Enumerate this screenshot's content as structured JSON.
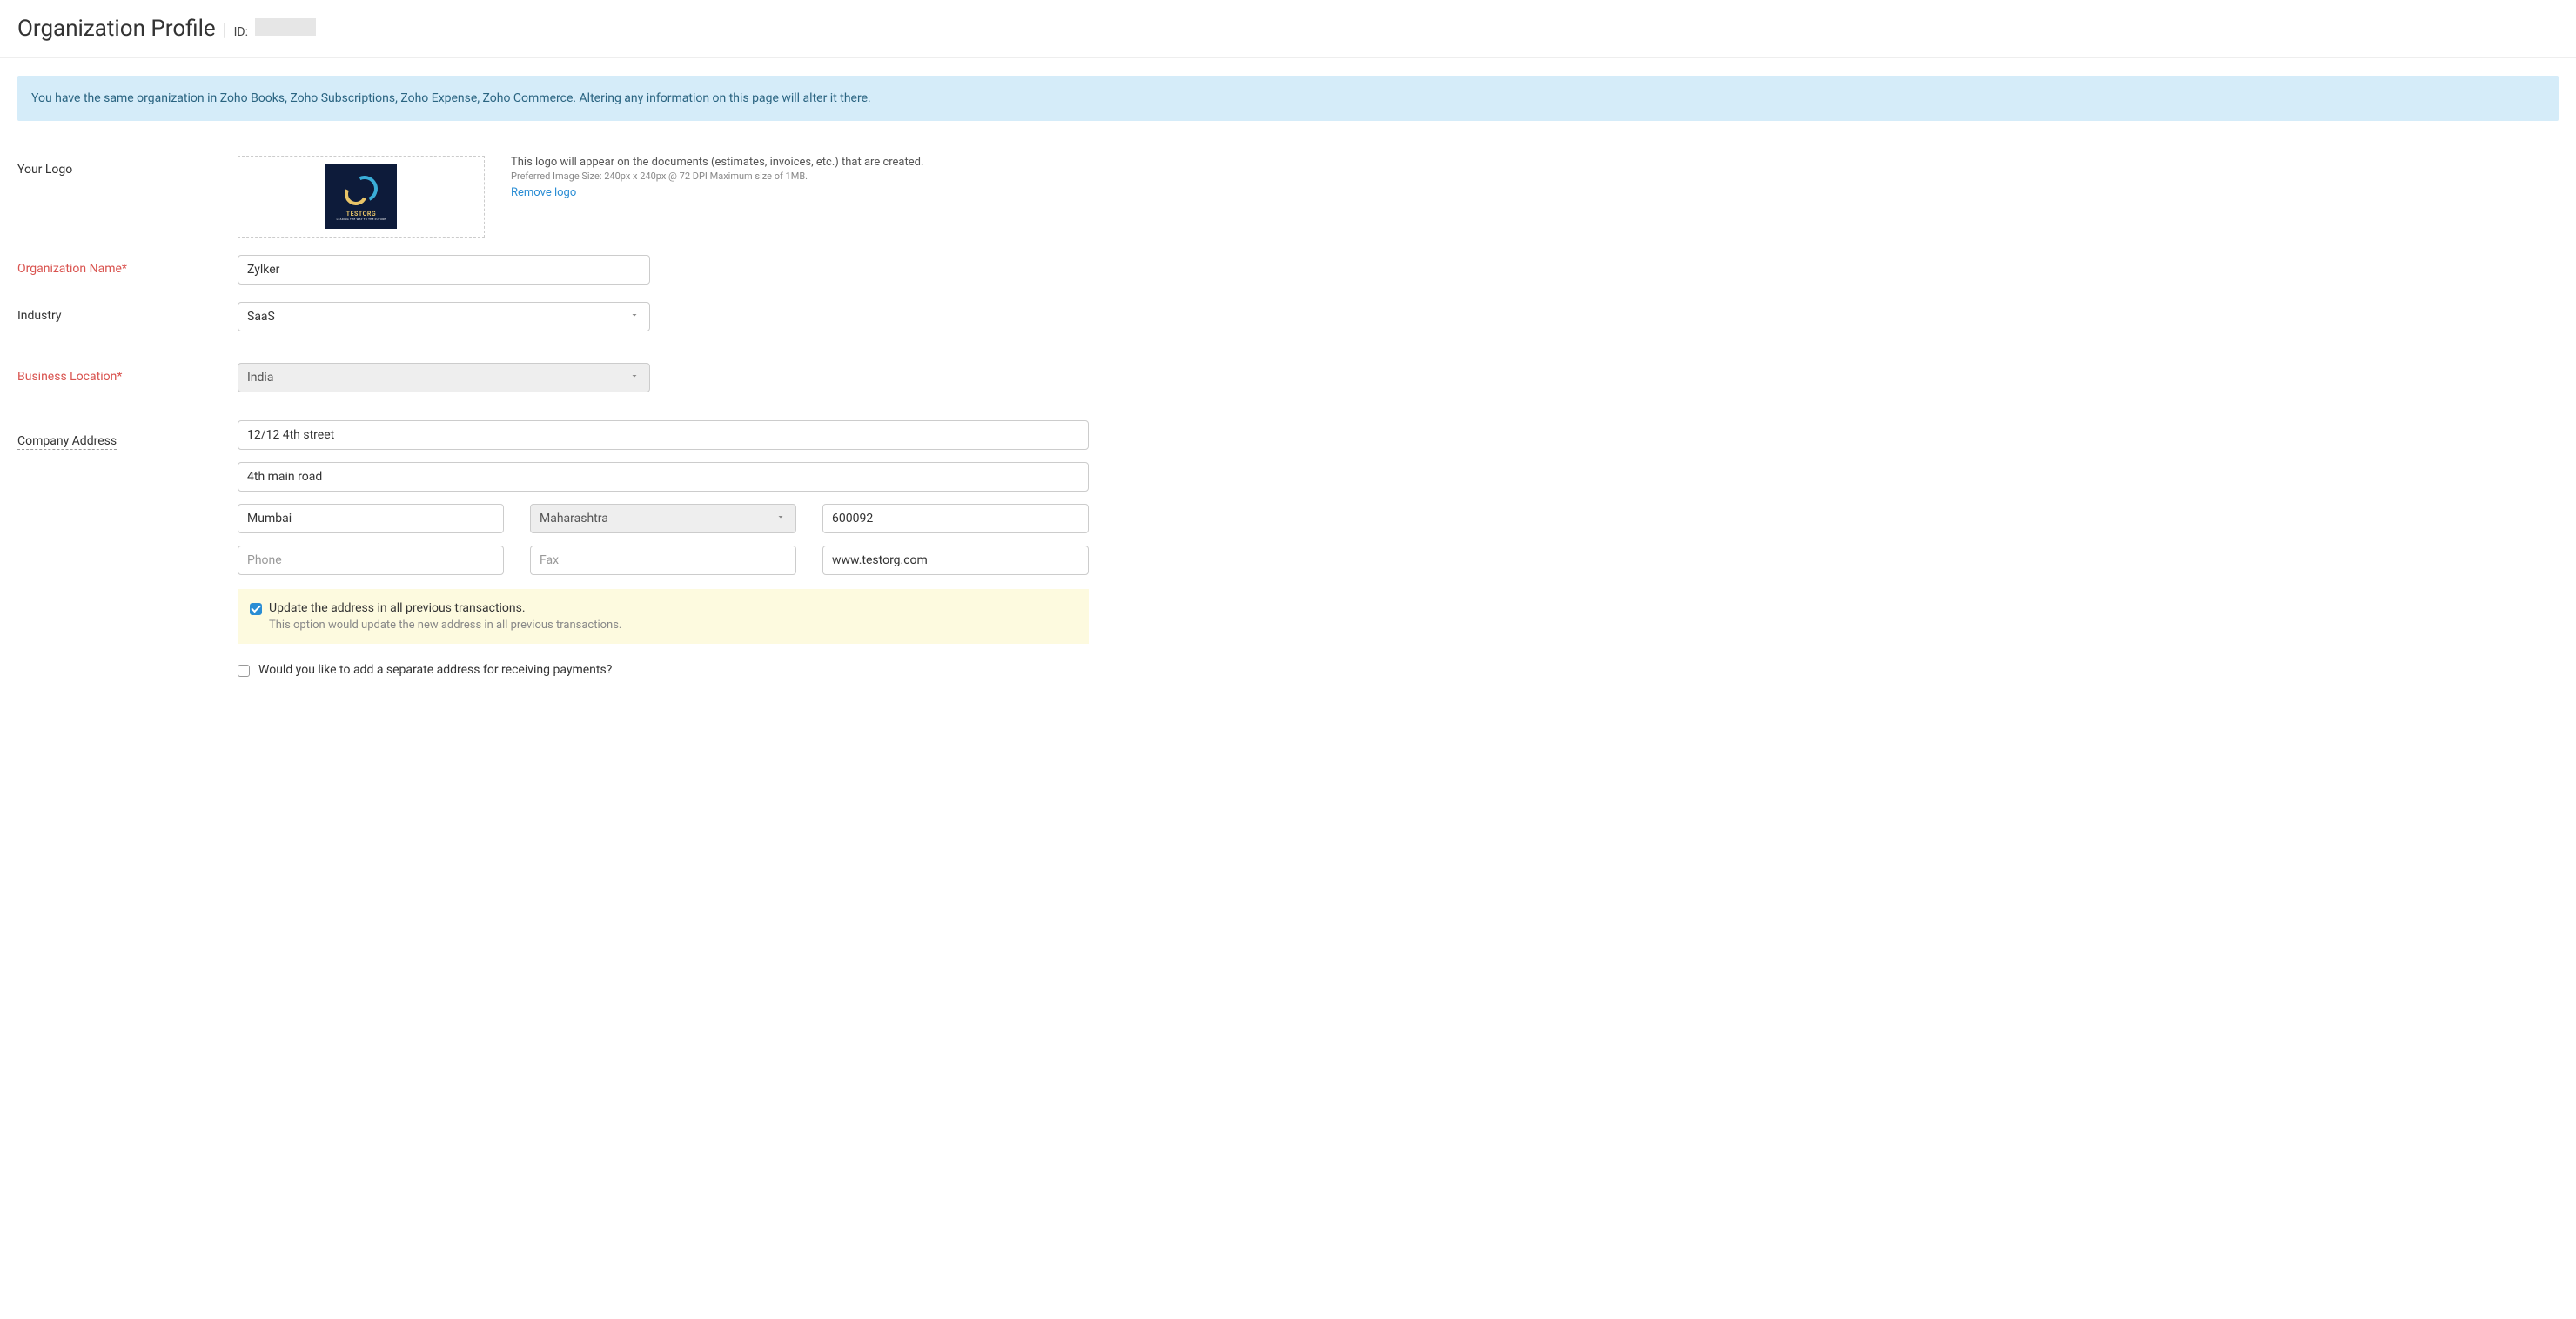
{
  "header": {
    "title": "Organization Profile",
    "id_label": "ID:"
  },
  "banner": {
    "text": "You have the same organization in Zoho Books, Zoho Subscriptions, Zoho Expense, Zoho Commerce. Altering any information on this page will alter it there."
  },
  "logo": {
    "label": "Your Logo",
    "brand_text": "TESTORG",
    "brand_subtext": "LEADING THE WAY TO THE FUTURE",
    "info_line1": "This logo will appear on the documents (estimates, invoices, etc.) that are created.",
    "info_line2": "Preferred Image Size: 240px x 240px @ 72 DPI Maximum size of 1MB.",
    "remove_link": "Remove logo"
  },
  "form": {
    "org_name_label": "Organization Name*",
    "org_name_value": "Zylker",
    "industry_label": "Industry",
    "industry_value": "SaaS",
    "business_location_label": "Business Location*",
    "business_location_value": "India",
    "company_address_label": "Company Address",
    "address_line1": "12/12 4th street",
    "address_line2": "4th main road",
    "city": "Mumbai",
    "state": "Maharashtra",
    "zip": "600092",
    "phone_placeholder": "Phone",
    "fax_placeholder": "Fax",
    "website": "www.testorg.com",
    "update_checkbox_label": "Update the address in all previous transactions.",
    "update_checkbox_sub": "This option would update the new address in all previous transactions.",
    "update_checkbox_checked": true,
    "separate_address_label": "Would you like to add a separate address for receiving payments?",
    "separate_address_checked": false
  }
}
